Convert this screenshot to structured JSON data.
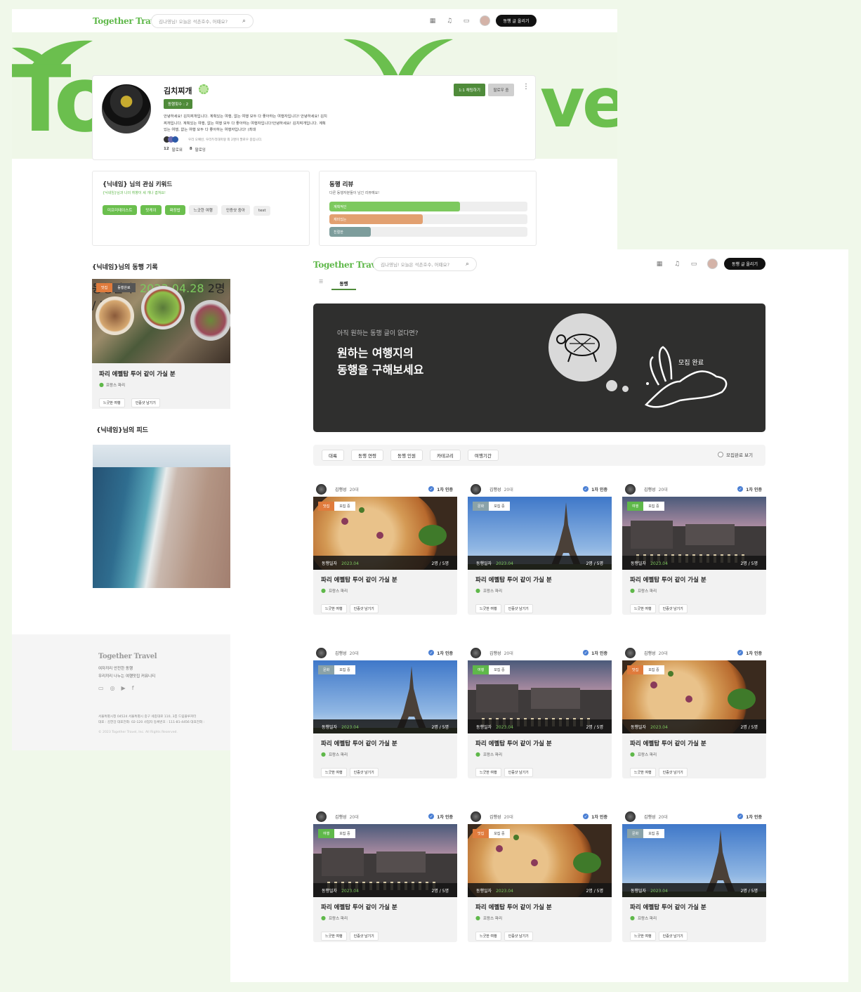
{
  "brand": {
    "logo": "Together Travel",
    "accent": "#6bbf4e",
    "dark": "#2f2f2e"
  },
  "header": {
    "search_placeholder": "김나영님! 오늘은 석촌호수, 어때요?",
    "write_button": "동행 글 올리기",
    "icons": [
      "calendar-icon",
      "bell-icon",
      "chat-icon"
    ]
  },
  "hero_letters": {
    "left": "To",
    "right": "ve"
  },
  "profile": {
    "name": "김치찌개",
    "badge": "동행횟수 : 2",
    "bio": "안녕하세요! 김치찌개입니다. 계획있는 여행, 없는 여행 모두 다 좋아하는 여행자입니다! 안녕하세요! 김치찌개입니다. 계획있는 여행, 없는 여행 모두 다 좋아하는 여행자입니다!안녕하세요! 김치찌개입니다. 계획있는 여행, 없는 여행 모두 다 좋아하는 여행자입니다! (최대",
    "mutual": "우리 오예빈, 우리두리대마왕 외 2명이 팔로우 중입니다.",
    "followers_count": "12",
    "followers_label": "팔로워",
    "following_count": "8",
    "following_label": "팔로잉",
    "chat_button": "1:1 채팅하기",
    "follow_button": "팔로우 중",
    "more": "⋮"
  },
  "keywords": {
    "title": "{닉네임} 님의 관심 키워드",
    "subtitle": "{닉네임}님과 나의 취향이 세 개나 겹쳐요!",
    "matched": [
      "미프미테이스트",
      "맛케이",
      "짜장밥"
    ],
    "others": [
      "느긋한 여행",
      "인증샷 중아",
      "test"
    ]
  },
  "review": {
    "title": "동행 리뷰",
    "subtitle": "다른 동행자분들이 남긴 리뷰예요!",
    "bars": [
      {
        "label": "계획적인",
        "value": 0.66,
        "color": "#7dc95e"
      },
      {
        "label": "재미있는",
        "value": 0.47,
        "color": "#e2a070"
      },
      {
        "label": "친절한",
        "value": 0.21,
        "color": "#7d9d9c"
      }
    ]
  },
  "record": {
    "title": "{닉네임}님의 동행 기록",
    "tag1": "맛집",
    "tag2": "동행완료",
    "date_label": "동행일자",
    "date": "2023.04.28",
    "count": "2명 / 5명",
    "card_title": "파리 에펠탑 투어 같이 가실 분",
    "location": "프랑스 파리",
    "tags": [
      "느긋한 여행",
      "인증샷 남기기"
    ]
  },
  "feed": {
    "title": "{닉네임}님의 피드"
  },
  "footer": {
    "logo": "Together Travel",
    "line1": "여자끼리 안전한 동행",
    "line2": "우리끼리 나누는 여행맛집 커뮤니티",
    "address": "서울특별시청 04524 서울특별시 중구 세종대로 110, 3층 드림플루커터",
    "biz": "대표 : 김한강 대표전화: 02-120 사업자 등록번호 : 111-81-4456 대표전화 :",
    "copy": "© 2023 Together Travel, Inc. All Rights Reserved."
  },
  "tabs": {
    "first": "☰",
    "active": "동행"
  },
  "banner": {
    "small": "아직 원하는 동행 글이 없다면?",
    "big1": "원하는 여행지의",
    "big2": "동행을 구해보세요",
    "rabbit_text": "모집 완료"
  },
  "filters": {
    "items": [
      "대륙",
      "동행 연령",
      "동행 인원",
      "카테고리",
      "여행기간"
    ],
    "toggle": "모집완료 보기"
  },
  "cards": [
    {
      "user": "김행성",
      "age": "20대",
      "verified": "1차 인증",
      "cat": "맛집",
      "cat_color": "#e07b3c",
      "status": "모집 중",
      "img": "pizza",
      "date_label": "동행일자",
      "date": "2023.04",
      "count": "2명 / 5명",
      "title": "파리 에펠탑 투어 같이 가실 분",
      "loc": "프랑스 파리",
      "tags": [
        "느긋한 여행",
        "인증샷 남기기"
      ]
    },
    {
      "user": "김행성",
      "age": "20대",
      "verified": "1차 인증",
      "cat": "문화",
      "cat_color": "#8aa2a8",
      "status": "모집 중",
      "img": "eiffel",
      "date_label": "동행일자",
      "date": "2023.04",
      "count": "2명 / 5명",
      "title": "파리 에펠탑 투어 같이 가실 분",
      "loc": "프랑스 파리",
      "tags": [
        "느긋한 여행",
        "인증샷 남기기"
      ]
    },
    {
      "user": "김행성",
      "age": "20대",
      "verified": "1차 인증",
      "cat": "여행",
      "cat_color": "#5fb84a",
      "status": "모집 중",
      "img": "city",
      "date_label": "동행일자",
      "date": "2023.04",
      "count": "2명 / 5명",
      "title": "파리 에펠탑 투어 같이 가실 분",
      "loc": "프랑스 파리",
      "tags": [
        "느긋한 여행",
        "인증샷 남기기"
      ]
    },
    {
      "user": "김행성",
      "age": "20대",
      "verified": "1차 인증",
      "cat": "문화",
      "cat_color": "#8aa2a8",
      "status": "모집 중",
      "img": "eiffel",
      "date_label": "동행일자",
      "date": "2023.04",
      "count": "2명 / 5명",
      "title": "파리 에펠탑 투어 같이 가실 분",
      "loc": "프랑스 파리",
      "tags": [
        "느긋한 여행",
        "인증샷 남기기"
      ]
    },
    {
      "user": "김행성",
      "age": "20대",
      "verified": "1차 인증",
      "cat": "여행",
      "cat_color": "#5fb84a",
      "status": "모집 중",
      "img": "city",
      "date_label": "동행일자",
      "date": "2023.04",
      "count": "2명 / 5명",
      "title": "파리 에펠탑 투어 같이 가실 분",
      "loc": "프랑스 파리",
      "tags": [
        "느긋한 여행",
        "인증샷 남기기"
      ]
    },
    {
      "user": "김행성",
      "age": "20대",
      "verified": "1차 인증",
      "cat": "맛집",
      "cat_color": "#e07b3c",
      "status": "모집 중",
      "img": "pizza",
      "date_label": "동행일자",
      "date": "2023.04",
      "count": "2명 / 5명",
      "title": "파리 에펠탑 투어 같이 가실 분",
      "loc": "프랑스 파리",
      "tags": [
        "느긋한 여행",
        "인증샷 남기기"
      ]
    },
    {
      "user": "김행성",
      "age": "20대",
      "verified": "1차 인증",
      "cat": "여행",
      "cat_color": "#5fb84a",
      "status": "모집 중",
      "img": "city",
      "date_label": "동행일자",
      "date": "2023.04",
      "count": "2명 / 5명",
      "title": "파리 에펠탑 투어 같이 가실 분",
      "loc": "프랑스 파리",
      "tags": [
        "느긋한 여행",
        "인증샷 남기기"
      ]
    },
    {
      "user": "김행성",
      "age": "20대",
      "verified": "1차 인증",
      "cat": "맛집",
      "cat_color": "#e07b3c",
      "status": "모집 중",
      "img": "pizza",
      "date_label": "동행일자",
      "date": "2023.04",
      "count": "2명 / 5명",
      "title": "파리 에펠탑 투어 같이 가실 분",
      "loc": "프랑스 파리",
      "tags": [
        "느긋한 여행",
        "인증샷 남기기"
      ]
    },
    {
      "user": "김행성",
      "age": "20대",
      "verified": "1차 인증",
      "cat": "문화",
      "cat_color": "#8aa2a8",
      "status": "모집 중",
      "img": "eiffel",
      "date_label": "동행일자",
      "date": "2023.04",
      "count": "2명 / 5명",
      "title": "파리 에펠탑 투어 같이 가실 분",
      "loc": "프랑스 파리",
      "tags": [
        "느긋한 여행",
        "인증샷 남기기"
      ]
    }
  ]
}
